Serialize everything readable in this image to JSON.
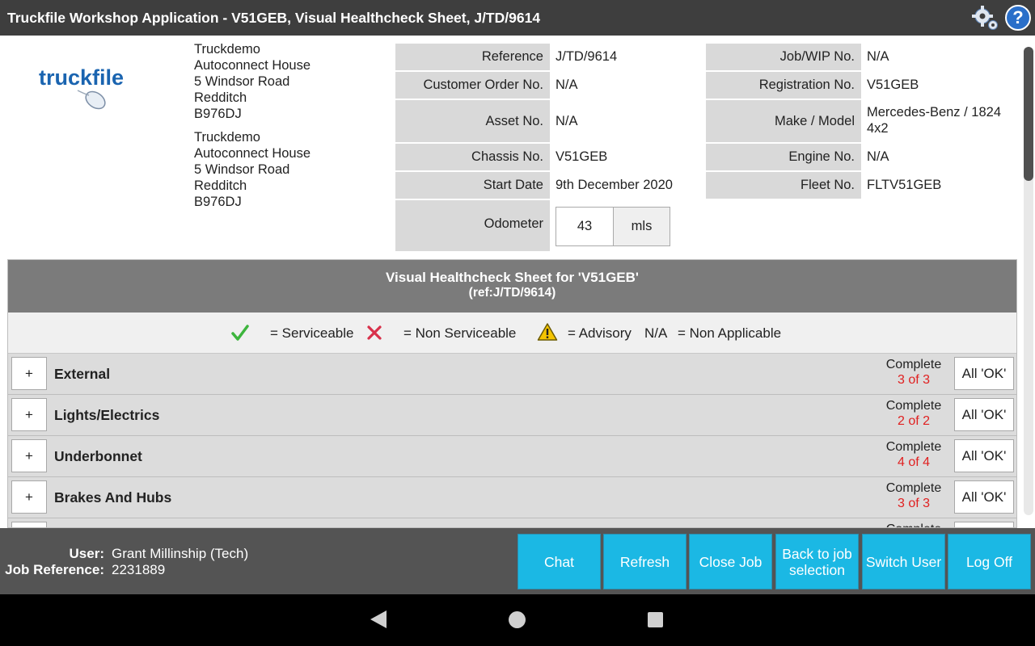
{
  "app": {
    "title": "Truckfile Workshop Application - V51GEB, Visual Healthcheck Sheet, J/TD/9614"
  },
  "icons": {
    "settings": "gear-icon",
    "help": "help-icon",
    "help_glyph": "?"
  },
  "logo": {
    "text": "truckfile"
  },
  "addresses": [
    [
      "Truckdemo",
      "Autoconnect House",
      "5 Windsor Road",
      "Redditch",
      "B976DJ"
    ],
    [
      "Truckdemo",
      "Autoconnect House",
      "5 Windsor Road",
      "Redditch",
      "B976DJ"
    ]
  ],
  "details_left": [
    {
      "label": "Reference",
      "value": "J/TD/9614"
    },
    {
      "label": "Customer Order No.",
      "value": "N/A"
    },
    {
      "label": "Asset No.",
      "value": "N/A"
    },
    {
      "label": "Chassis No.",
      "value": "V51GEB"
    },
    {
      "label": "Start Date",
      "value": "9th December 2020"
    },
    {
      "label": "Odometer",
      "value": "43",
      "unit": "mls"
    }
  ],
  "details_right": [
    {
      "label": "Job/WIP No.",
      "value": "N/A"
    },
    {
      "label": "Registration No.",
      "value": "V51GEB"
    },
    {
      "label": "Make / Model",
      "value": "Mercedes-Benz / 1824 4x2"
    },
    {
      "label": "Engine No.",
      "value": "N/A"
    },
    {
      "label": "Fleet No.",
      "value": "FLTV51GEB"
    }
  ],
  "sheet": {
    "title": "Visual Healthcheck Sheet for 'V51GEB'",
    "subtitle": "(ref:J/TD/9614)",
    "legend": {
      "serviceable": "= Serviceable",
      "non_serviceable": "= Non Serviceable",
      "advisory": "= Advisory",
      "na_code": "N/A",
      "non_applicable": "= Non Applicable"
    },
    "sections": [
      {
        "name": "External",
        "complete_label": "Complete",
        "count": "3 of 3",
        "expand": "+",
        "all_ok": "All 'OK'"
      },
      {
        "name": "Lights/Electrics",
        "complete_label": "Complete",
        "count": "2 of 2",
        "expand": "+",
        "all_ok": "All 'OK'"
      },
      {
        "name": "Underbonnet",
        "complete_label": "Complete",
        "count": "4 of 4",
        "expand": "+",
        "all_ok": "All 'OK'"
      },
      {
        "name": "Brakes And Hubs",
        "complete_label": "Complete",
        "count": "3 of 3",
        "expand": "+",
        "all_ok": "All 'OK'"
      },
      {
        "name": "",
        "complete_label": "Complete",
        "count": "",
        "expand": "+",
        "all_ok": ""
      }
    ]
  },
  "footer": {
    "user_label": "User:",
    "user_value": "Grant Millinship (Tech)",
    "jobref_label": "Job Reference:",
    "jobref_value": "2231889",
    "buttons": [
      {
        "id": "chat",
        "label": "Chat"
      },
      {
        "id": "refresh",
        "label": "Refresh"
      },
      {
        "id": "close-job",
        "label": "Close Job"
      },
      {
        "id": "back-to-job-selection",
        "label": "Back to job selection"
      },
      {
        "id": "switch-user",
        "label": "Switch User"
      },
      {
        "id": "log-off",
        "label": "Log Off"
      }
    ]
  },
  "colors": {
    "accent_button": "#1bb8e4",
    "titlebar": "#3e3e3e",
    "count_red": "#e02020",
    "section_header": "#7b7b7b"
  }
}
